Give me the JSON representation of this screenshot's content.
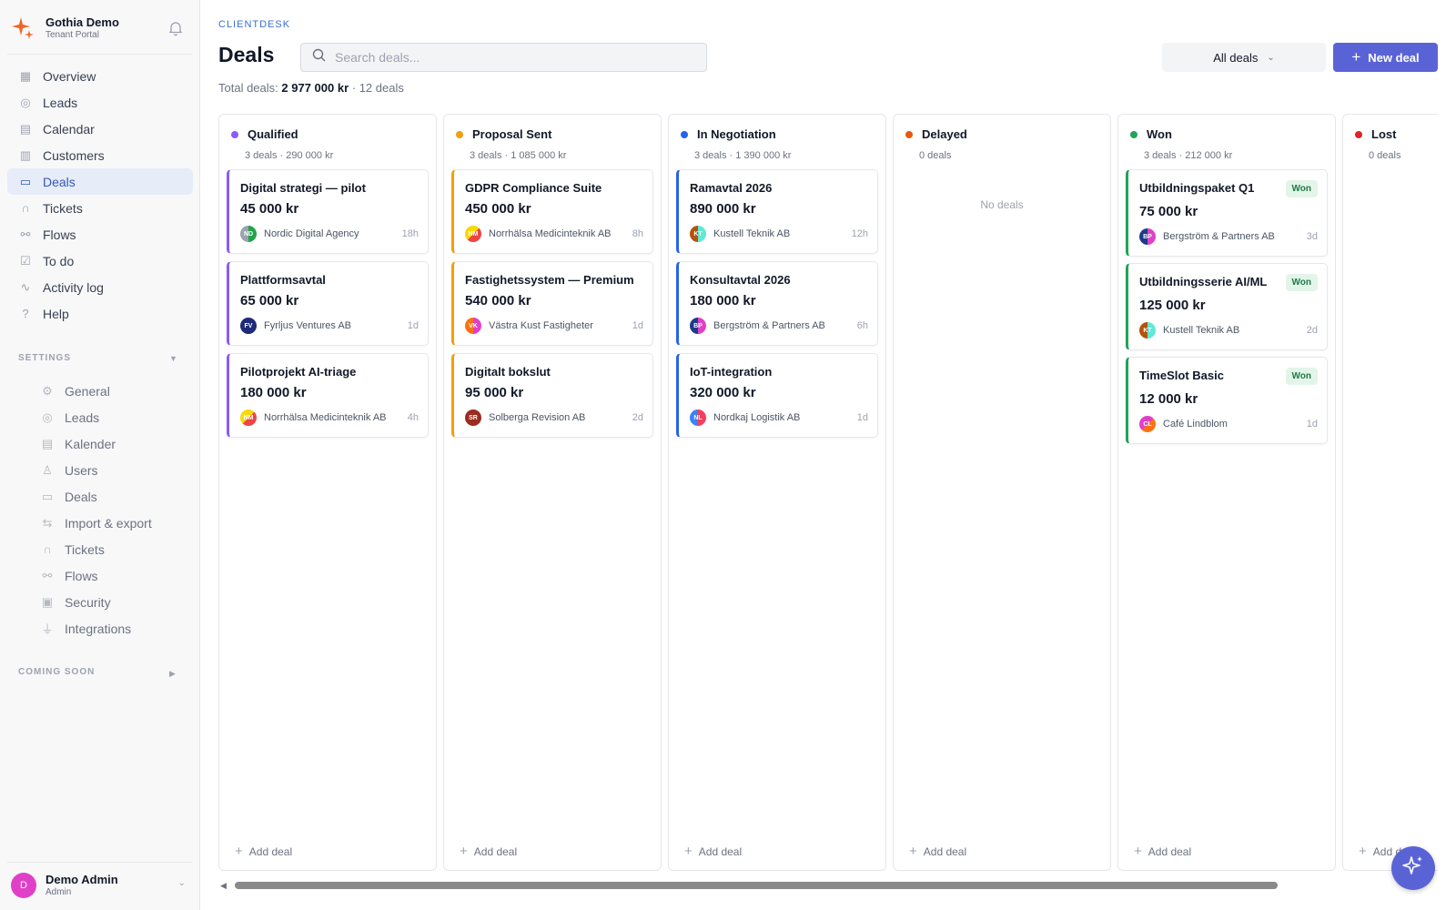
{
  "brand": {
    "name": "Gothia Demo",
    "subtitle": "Tenant Portal"
  },
  "nav": [
    {
      "label": "Overview",
      "icon": "grid-icon"
    },
    {
      "label": "Leads",
      "icon": "target-icon"
    },
    {
      "label": "Calendar",
      "icon": "calendar-icon"
    },
    {
      "label": "Customers",
      "icon": "building-icon"
    },
    {
      "label": "Deals",
      "icon": "briefcase-icon",
      "active": true
    },
    {
      "label": "Tickets",
      "icon": "headset-icon"
    },
    {
      "label": "Flows",
      "icon": "flow-icon"
    },
    {
      "label": "To do",
      "icon": "checkbox-icon"
    },
    {
      "label": "Activity log",
      "icon": "activity-icon"
    },
    {
      "label": "Help",
      "icon": "help-icon"
    }
  ],
  "settings_label": "SETTINGS",
  "settings_nav": [
    {
      "label": "General",
      "icon": "gear-icon"
    },
    {
      "label": "Leads",
      "icon": "target-icon"
    },
    {
      "label": "Kalender",
      "icon": "calendar-icon"
    },
    {
      "label": "Users",
      "icon": "users-icon"
    },
    {
      "label": "Deals",
      "icon": "briefcase-icon"
    },
    {
      "label": "Import & export",
      "icon": "arrows-icon"
    },
    {
      "label": "Tickets",
      "icon": "headset-icon"
    },
    {
      "label": "Flows",
      "icon": "flow-icon"
    },
    {
      "label": "Security",
      "icon": "lock-icon"
    },
    {
      "label": "Integrations",
      "icon": "plug-icon"
    }
  ],
  "coming_soon_label": "COMING SOON",
  "user": {
    "initial": "D",
    "name": "Demo Admin",
    "role": "Admin"
  },
  "header": {
    "eyebrow": "CLIENTDESK",
    "title": "Deals",
    "search_placeholder": "Search deals...",
    "filter_label": "All deals",
    "new_button": "New deal"
  },
  "totals": {
    "prefix": "Total deals:",
    "amount": "2 977 000 kr",
    "count": "· 12 deals"
  },
  "columns": [
    {
      "name": "Qualified",
      "color": "#8b5cf6",
      "summary": "3 deals · 290 000 kr",
      "cards": [
        {
          "title": "Digital strategi — pilot",
          "amount": "45 000 kr",
          "company": "Nordic Digital Agency",
          "initials": "ND",
          "age": "18h",
          "avatar": "linear-gradient(90deg,#9ca3af 50%,#22a34a 50%)"
        },
        {
          "title": "Plattformsavtal",
          "amount": "65 000 kr",
          "company": "Fyrljus Ventures AB",
          "initials": "FV",
          "age": "1d",
          "avatar": "#1e2a78"
        },
        {
          "title": "Pilotprojekt AI-triage",
          "amount": "180 000 kr",
          "company": "Norrhälsa Medicinteknik AB",
          "initials": "NM",
          "age": "4h",
          "avatar": "linear-gradient(135deg,#f5d90a 50%,#ef4444 50%)"
        }
      ],
      "add_label": "Add deal"
    },
    {
      "name": "Proposal Sent",
      "color": "#f59e0b",
      "summary": "3 deals · 1 085 000 kr",
      "cards": [
        {
          "title": "GDPR Compliance Suite",
          "amount": "450 000 kr",
          "company": "Norrhälsa Medicinteknik AB",
          "initials": "NM",
          "age": "8h",
          "avatar": "linear-gradient(135deg,#f5d90a 50%,#ef4444 50%)"
        },
        {
          "title": "Fastighetssystem — Premium",
          "amount": "540 000 kr",
          "company": "Västra Kust Fastigheter",
          "initials": "VK",
          "age": "1d",
          "avatar": "linear-gradient(90deg,#f97316 50%,#e040c8 50%)"
        },
        {
          "title": "Digitalt bokslut",
          "amount": "95 000 kr",
          "company": "Solberga Revision AB",
          "initials": "SR",
          "age": "2d",
          "avatar": "#9b2c1f"
        }
      ],
      "add_label": "Add deal"
    },
    {
      "name": "In Negotiation",
      "color": "#2563eb",
      "summary": "3 deals · 1 390 000 kr",
      "cards": [
        {
          "title": "Ramavtal 2026",
          "amount": "890 000 kr",
          "company": "Kustell Teknik AB",
          "initials": "KT",
          "age": "12h",
          "avatar": "linear-gradient(90deg,#b45309 50%,#5eead4 50%)"
        },
        {
          "title": "Konsultavtal 2026",
          "amount": "180 000 kr",
          "company": "Bergström & Partners AB",
          "initials": "BP",
          "age": "6h",
          "avatar": "linear-gradient(90deg,#1e3a8a 50%,#e040c8 50%)"
        },
        {
          "title": "IoT-integration",
          "amount": "320 000 kr",
          "company": "Nordkaj Logistik AB",
          "initials": "NL",
          "age": "1d",
          "avatar": "linear-gradient(90deg,#3b82f6 50%,#f43f5e 50%)"
        }
      ],
      "add_label": "Add deal"
    },
    {
      "name": "Delayed",
      "color": "#ea580c",
      "summary": "0 deals",
      "cards": [],
      "empty_label": "No deals",
      "add_label": "Add deal"
    },
    {
      "name": "Won",
      "color": "#22a35a",
      "summary": "3 deals · 212 000 kr",
      "cards": [
        {
          "title": "Utbildningspaket Q1",
          "amount": "75 000 kr",
          "company": "Bergström & Partners AB",
          "initials": "BP",
          "age": "3d",
          "badge": "Won",
          "avatar": "linear-gradient(90deg,#1e3a8a 50%,#e040c8 50%)"
        },
        {
          "title": "Utbildningsserie AI/ML",
          "amount": "125 000 kr",
          "company": "Kustell Teknik AB",
          "initials": "KT",
          "age": "2d",
          "badge": "Won",
          "avatar": "linear-gradient(90deg,#b45309 50%,#5eead4 50%)"
        },
        {
          "title": "TimeSlot Basic",
          "amount": "12 000 kr",
          "company": "Café Lindblom",
          "initials": "CL",
          "age": "1d",
          "badge": "Won",
          "avatar": "linear-gradient(135deg,#e040c8 50%,#f97316 50%)"
        }
      ],
      "add_label": "Add deal"
    },
    {
      "name": "Lost",
      "color": "#dc2626",
      "summary": "0 deals",
      "cards": [],
      "add_label": "Add deal"
    }
  ]
}
